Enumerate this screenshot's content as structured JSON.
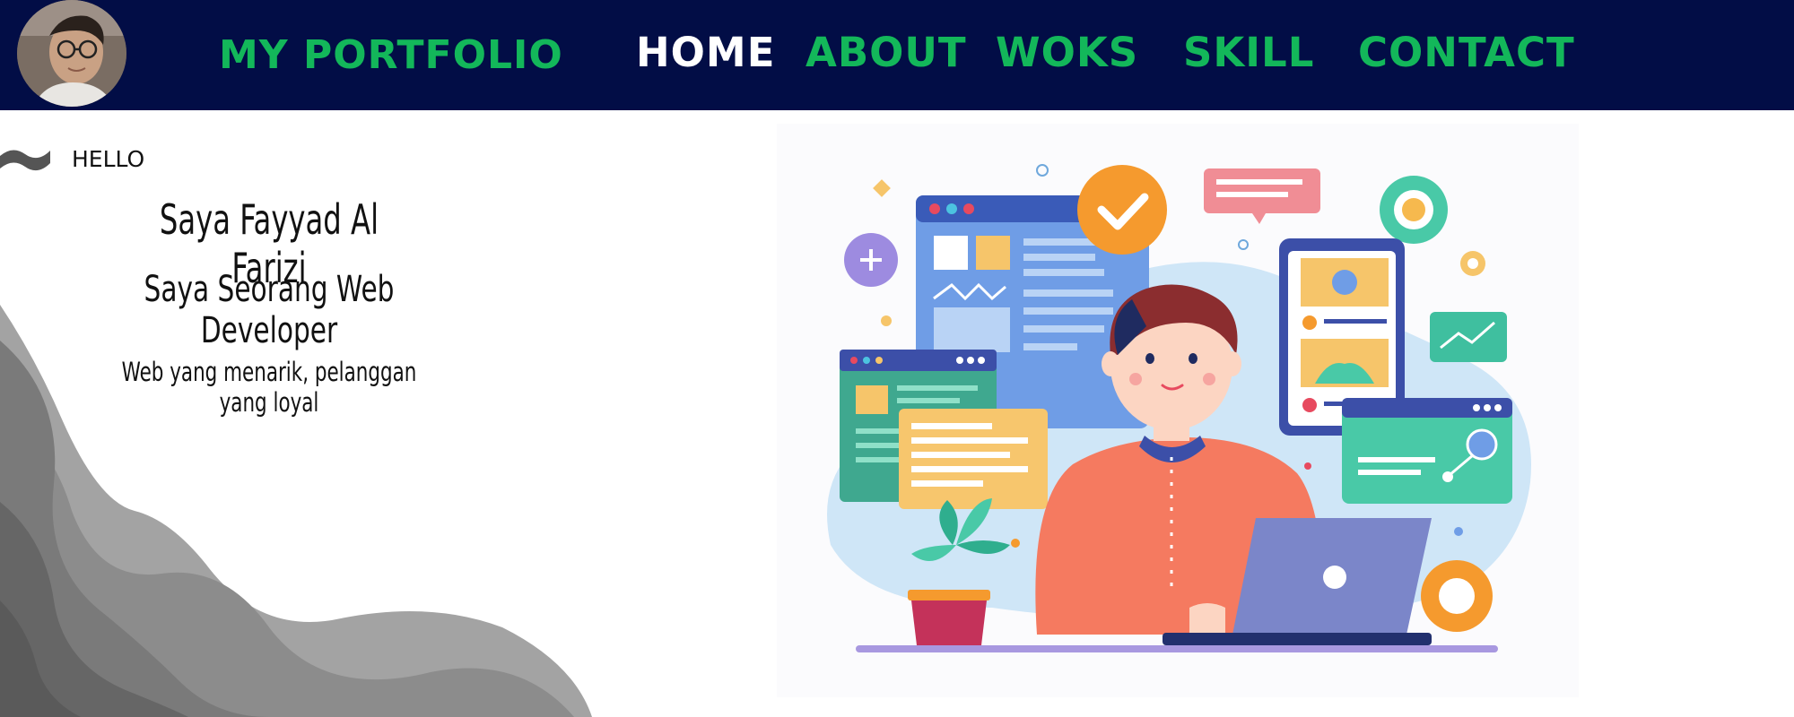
{
  "nav": {
    "brand": "MY PORTFOLIO",
    "links": [
      {
        "label": "HOME",
        "active": true
      },
      {
        "label": "ABOUT",
        "active": false
      },
      {
        "label": "WOKS",
        "active": false
      },
      {
        "label": "SKILL",
        "active": false
      },
      {
        "label": "CONTACT",
        "active": false
      }
    ]
  },
  "hero": {
    "greeting": "HELLO",
    "name": "Saya Fayyad Al Farizi",
    "role": "Saya Seorang Web Developer",
    "tagline": "Web yang menarik, pelanggan yang loyal"
  },
  "colors": {
    "navbar_bg": "#020d46",
    "accent_green": "#13b75a",
    "active_link": "#ffffff"
  },
  "icons": {
    "avatar": "profile-photo",
    "illustration": "web-developer-illustration"
  }
}
